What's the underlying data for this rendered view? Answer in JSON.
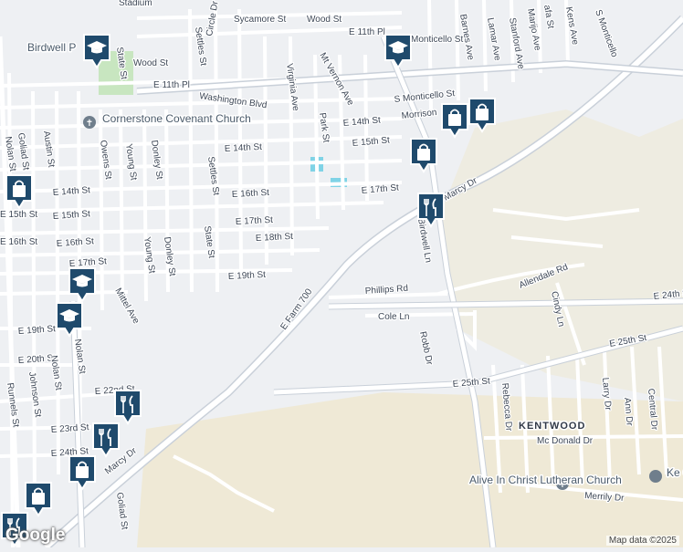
{
  "map": {
    "attribution": "Map data ©2025",
    "logo": "Google",
    "streets": [
      "E 11th Pl",
      "E 11th Pl",
      "E 14th St",
      "E 15th St",
      "E 16th St",
      "E 17th St",
      "E 18th St",
      "E 19th St",
      "E 17th St",
      "E 16th St",
      "E 15th St",
      "E 14th St",
      "E 14th St",
      "E 15th St",
      "E 16th St",
      "E 17th St",
      "E 19th St",
      "E 20th St",
      "E 22nd St",
      "E 23rd St",
      "E 24th St",
      "E 25th St",
      "E 25th St",
      "E 24th St",
      "Sycamore St",
      "Wood St",
      "Wood St",
      "Washington Blvd",
      "Mt Vernon Ave",
      "S Monticello St",
      "Monticello St",
      "Morrison",
      "Virginia Ave",
      "Park St",
      "Settles St",
      "Settles St",
      "State St",
      "State St",
      "Young St",
      "Young St",
      "Donley St",
      "Donley St",
      "Owens St",
      "Austin St",
      "Goliad St",
      "Nolan St",
      "Nolan St",
      "Johnson St",
      "Runnels St",
      "Mittel Ave",
      "E Farm 700",
      "Marcy Dr",
      "Marcy Dr",
      "Phillips Rd",
      "Cole Ln",
      "Allendale Rd",
      "Cindy Ln",
      "Robb Dr",
      "Birdwell Ln",
      "Rebecca Dr",
      "Larry Dr",
      "Ann Dr",
      "Central Dr",
      "Mc Donald Dr",
      "Merrily Dr",
      "Barnes Ave",
      "Lamar Ave",
      "Stanford Ave",
      "Marijo Ave",
      "S Monticello",
      "Goliad St",
      "Circle Dr",
      "Stadium",
      "Nolan St",
      "Kens Ave",
      "afa St"
    ],
    "places": [
      "Birdwell P",
      "Cornerstone Covenant Church",
      "Alive In Christ Lutheran Church",
      "Ke C"
    ],
    "areas": [
      "KENTWOOD"
    ],
    "pins": [
      {
        "icon": "school-icon"
      },
      {
        "icon": "school-icon"
      },
      {
        "icon": "school-icon"
      },
      {
        "icon": "school-icon"
      },
      {
        "icon": "shopping-bag-icon"
      },
      {
        "icon": "shopping-bag-icon"
      },
      {
        "icon": "shopping-bag-icon"
      },
      {
        "icon": "shopping-bag-icon"
      },
      {
        "icon": "shopping-bag-icon"
      },
      {
        "icon": "shopping-bag-icon"
      },
      {
        "icon": "restaurant-icon"
      },
      {
        "icon": "restaurant-icon"
      },
      {
        "icon": "restaurant-icon"
      },
      {
        "icon": "restaurant-icon"
      }
    ],
    "colors": {
      "background": "#eef0f3",
      "road": "#ffffff",
      "highway": "#d5dae1",
      "park": "#c8e6c0",
      "sand": "#efe9d6",
      "pin_dark": "#1f4a6c",
      "pin_border": "#ffffff",
      "water": "#7fd3e6"
    }
  }
}
